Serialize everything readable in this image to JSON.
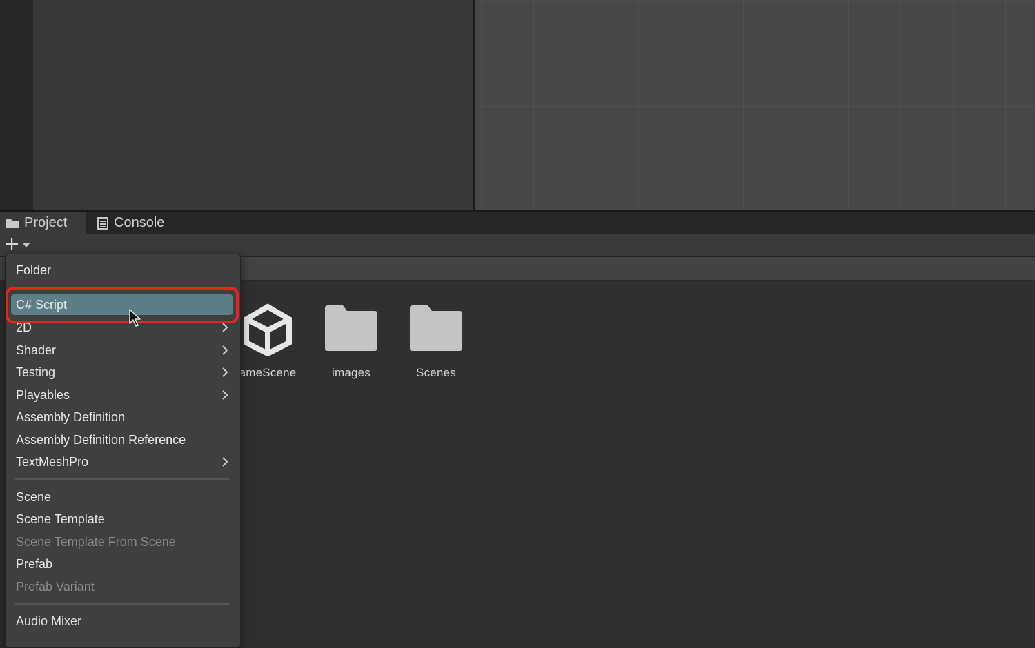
{
  "tabs": {
    "project": "Project",
    "console": "Console"
  },
  "toolbar": {
    "add_icon": "plus-icon",
    "dropdown_icon": "caret-down-icon"
  },
  "assets": [
    {
      "label": "ameScene",
      "icon": "unity-scene-icon"
    },
    {
      "label": "images",
      "icon": "folder-icon"
    },
    {
      "label": "Scenes",
      "icon": "folder-icon"
    }
  ],
  "menu": {
    "items": [
      {
        "label": "Folder",
        "submenu": false,
        "enabled": true
      },
      {
        "label": "C# Script",
        "submenu": false,
        "enabled": true,
        "selected": true
      },
      {
        "label": "2D",
        "submenu": true,
        "enabled": true
      },
      {
        "label": "Shader",
        "submenu": true,
        "enabled": true
      },
      {
        "label": "Testing",
        "submenu": true,
        "enabled": true
      },
      {
        "label": "Playables",
        "submenu": true,
        "enabled": true
      },
      {
        "label": "Assembly Definition",
        "submenu": false,
        "enabled": true
      },
      {
        "label": "Assembly Definition Reference",
        "submenu": false,
        "enabled": true
      },
      {
        "label": "TextMeshPro",
        "submenu": true,
        "enabled": true
      },
      {
        "label": "Scene",
        "submenu": false,
        "enabled": true
      },
      {
        "label": "Scene Template",
        "submenu": false,
        "enabled": true
      },
      {
        "label": "Scene Template From Scene",
        "submenu": false,
        "enabled": false
      },
      {
        "label": "Prefab",
        "submenu": false,
        "enabled": true
      },
      {
        "label": "Prefab Variant",
        "submenu": false,
        "enabled": false
      },
      {
        "label": "Audio Mixer",
        "submenu": false,
        "enabled": true
      }
    ]
  },
  "colors": {
    "selection": "#5d7d87",
    "highlight_ring": "#e8241d"
  }
}
